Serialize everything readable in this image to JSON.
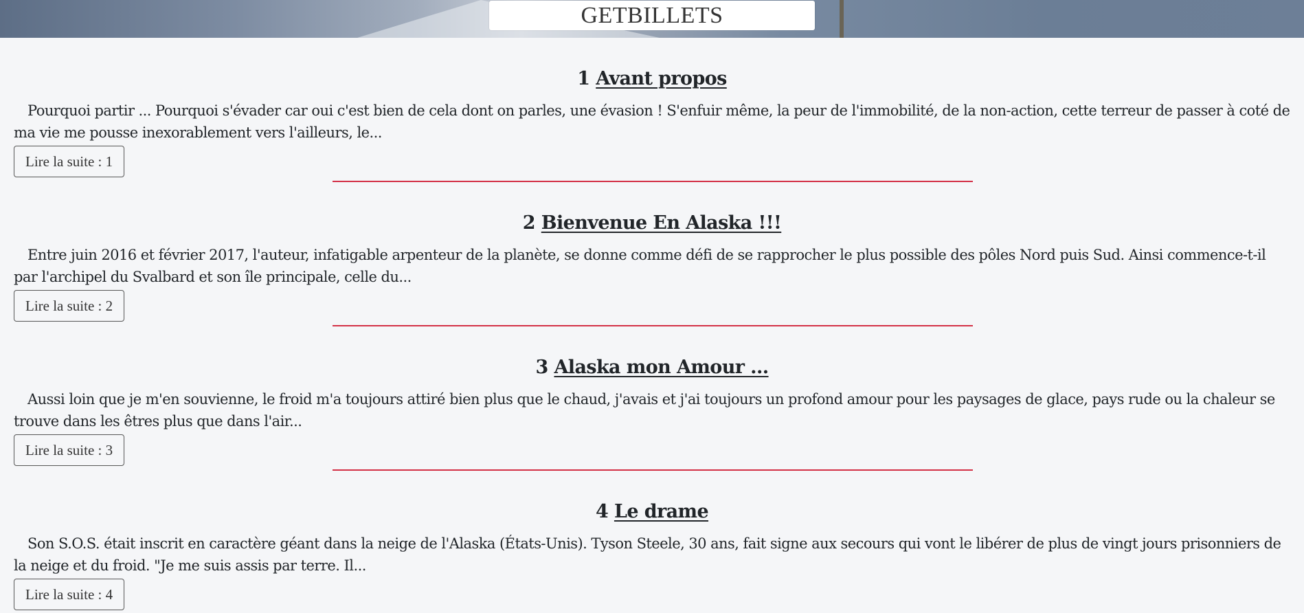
{
  "site": {
    "title": "GETBILLETS"
  },
  "articles": [
    {
      "number": "1",
      "title": "Avant propos",
      "excerpt": "Pourquoi partir ... Pourquoi s'évader car oui c'est bien de cela dont on parles, une évasion ! S'enfuir même, la peur de l'immobilité, de la non-action, cette terreur de passer à coté de ma vie me pousse inexorablement vers l'ailleurs, le...",
      "read_more": "Lire la suite : 1"
    },
    {
      "number": "2",
      "title": "Bienvenue En Alaska !!!",
      "excerpt": "Entre juin 2016 et février 2017, l'auteur, infatigable arpenteur de la planète, se donne comme défi de se rapprocher le plus possible des pôles Nord puis Sud. Ainsi commence-t-il par l'archipel du Svalbard et son île principale, celle du...",
      "read_more": "Lire la suite : 2"
    },
    {
      "number": "3",
      "title": "Alaska mon Amour ...",
      "excerpt": "Aussi loin que je m'en souvienne, le froid m'a toujours attiré bien plus que le chaud, j'avais et j'ai toujours un profond amour pour les paysages de glace, pays rude ou la chaleur se trouve dans les êtres plus que dans l'air...",
      "read_more": "Lire la suite : 3"
    },
    {
      "number": "4",
      "title": "Le drame",
      "excerpt": "Son S.O.S. était inscrit en caractère géant dans la neige de l'Alaska (États-Unis). Tyson Steele, 30 ans, fait signe aux secours qui vont le libérer de plus de vingt jours prisonniers de la neige et du froid. \"Je me suis assis par terre. Il...",
      "read_more": "Lire la suite : 4"
    }
  ],
  "colors": {
    "background": "#f5f6f8",
    "divider": "#d32f45",
    "text": "#212529"
  }
}
